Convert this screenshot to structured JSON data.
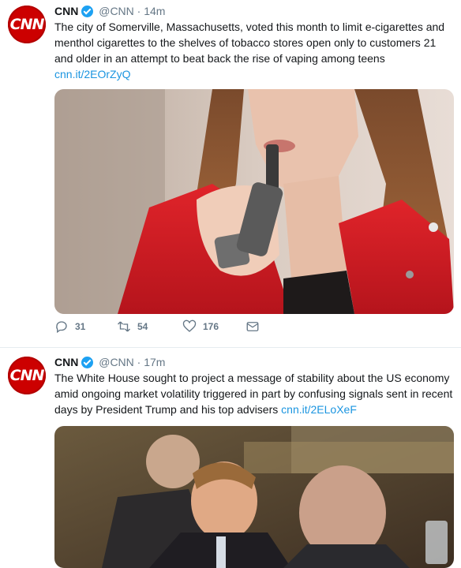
{
  "tweets": [
    {
      "author": "CNN",
      "avatar_text": "CNN",
      "handle": "@CNN",
      "separator": "·",
      "time": "14m",
      "text": "The city of Somerville, Massachusetts, voted this month to limit e-cigarettes and menthol cigarettes to the shelves of tobacco stores open only to customers 21 and older in an attempt to beat back the rise of vaping among teens",
      "link": "cnn.it/2EOrZyQ",
      "actions": {
        "replies": "31",
        "retweets": "54",
        "likes": "176"
      }
    },
    {
      "author": "CNN",
      "avatar_text": "CNN",
      "handle": "@CNN",
      "separator": "·",
      "time": "17m",
      "text": "The White House sought to project a message of stability about the US economy amid ongoing market volatility triggered in part by confusing signals sent in recent days by President Trump and his top advisers",
      "link": "cnn.it/2ELoXeF"
    }
  ],
  "colors": {
    "brand": "#cc0000",
    "link": "#1b95e0",
    "verified": "#1da1f2",
    "muted": "#657786"
  },
  "icons": [
    "verified-badge-icon",
    "reply-icon",
    "retweet-icon",
    "like-icon",
    "direct-message-icon"
  ]
}
